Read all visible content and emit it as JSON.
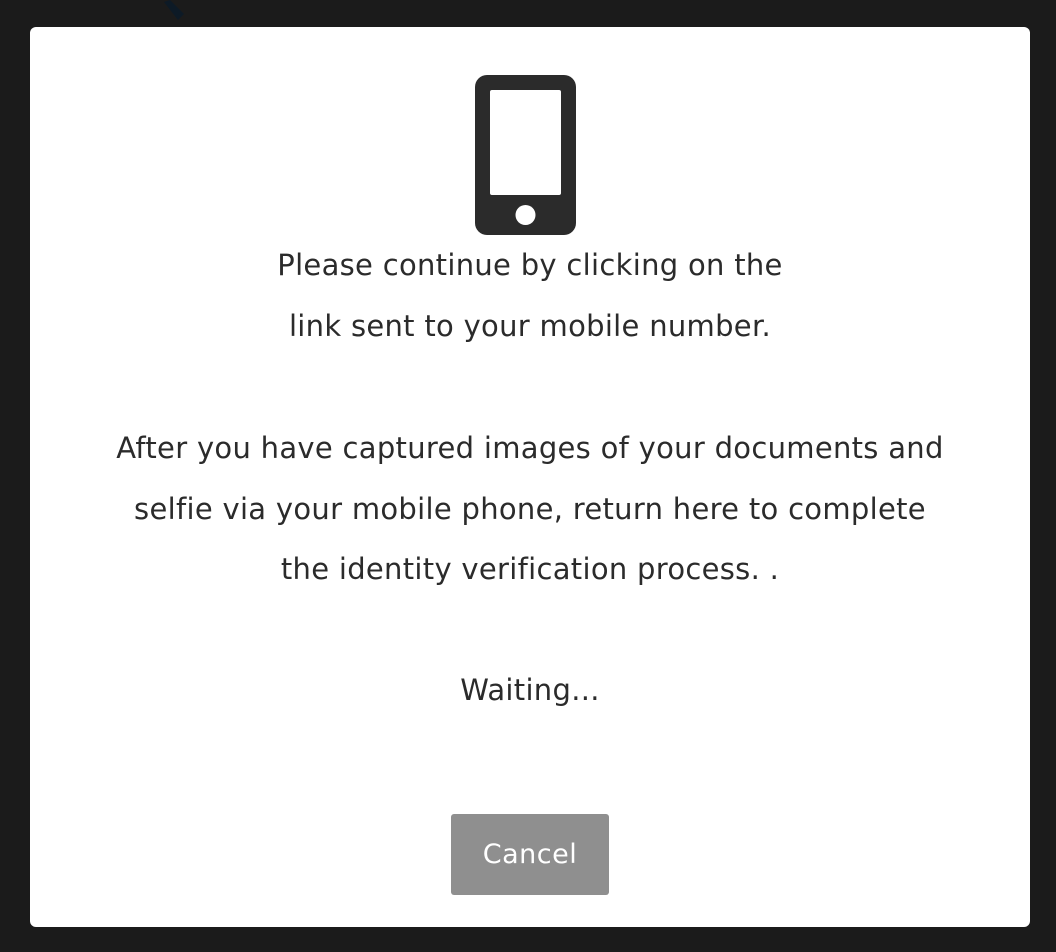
{
  "modal": {
    "icon": "mobile-phone-icon",
    "message_1_lines": [
      "Please continue by clicking on the",
      "link sent to your mobile number."
    ],
    "message_2_lines": [
      "After you have captured images of your documents and",
      "selfie via your mobile phone, return here to complete",
      "the identity verification process. ."
    ],
    "status_text": "Waiting...",
    "cancel_label": "Cancel"
  },
  "colors": {
    "backdrop": "#1b1b1b",
    "modal_background": "#ffffff",
    "text": "#2b2b2b",
    "icon": "#2b2b2b",
    "cancel_button_bg": "#8f8f8f",
    "cancel_button_text": "#ffffff"
  }
}
